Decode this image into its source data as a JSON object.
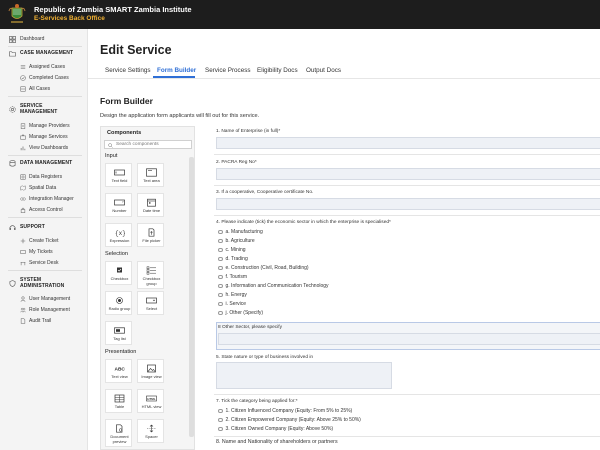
{
  "header": {
    "title": "Republic of Zambia SMART Zambia Institute",
    "subtitle": "E-Services Back Office"
  },
  "sidebar": {
    "dashboard": "Dashboard",
    "sections": [
      {
        "title": "CASE MANAGEMENT",
        "items": [
          "Assigned Cases",
          "Completed Cases",
          "All Cases"
        ]
      },
      {
        "title": "SERVICE\nMANAGEMENT",
        "items": [
          "Manage Providers",
          "Manage Services",
          "View Dashboards"
        ]
      },
      {
        "title": "DATA MANAGEMENT",
        "items": [
          "Data Registers",
          "Spatial Data",
          "Integration Manager",
          "Access Control"
        ]
      },
      {
        "title": "SUPPORT",
        "items": [
          "Create Ticket",
          "My Tickets",
          "Service Desk"
        ]
      },
      {
        "title": "SYSTEM\nADMINISTRATION",
        "items": [
          "User Management",
          "Role Management",
          "Audit Trail"
        ]
      }
    ]
  },
  "page": {
    "title": "Edit Service",
    "tabs": [
      "Service Settings",
      "Form Builder",
      "Service Process",
      "Eligibility Docs",
      "Output Docs"
    ],
    "active_tab": "Form Builder"
  },
  "form_builder": {
    "title": "Form Builder",
    "description": "Design the application form applicants will fill out for this service."
  },
  "components": {
    "title": "Components",
    "search_placeholder": "Search components",
    "sections": [
      {
        "label": "Input",
        "items": [
          {
            "label": "Text field",
            "icon": "text-field-icon"
          },
          {
            "label": "Text area",
            "icon": "text-area-icon"
          },
          {
            "label": "Number",
            "icon": "number-icon"
          },
          {
            "label": "Date time",
            "icon": "date-time-icon"
          },
          {
            "label": "Expression",
            "icon": "expression-icon"
          },
          {
            "label": "File picker",
            "icon": "file-picker-icon"
          }
        ]
      },
      {
        "label": "Selection",
        "items": [
          {
            "label": "Checkbox",
            "icon": "checkbox-icon"
          },
          {
            "label": "Checkbox group",
            "icon": "checkbox-group-icon"
          },
          {
            "label": "Radio group",
            "icon": "radio-group-icon"
          },
          {
            "label": "Select",
            "icon": "select-icon"
          },
          {
            "label": "Tag list",
            "icon": "tag-list-icon"
          }
        ]
      },
      {
        "label": "Presentation",
        "items": [
          {
            "label": "Text view",
            "icon": "text-view-icon"
          },
          {
            "label": "Image view",
            "icon": "image-view-icon"
          },
          {
            "label": "Table",
            "icon": "table-icon"
          },
          {
            "label": "HTML view",
            "icon": "html-view-icon"
          },
          {
            "label": "Document preview",
            "icon": "document-preview-icon"
          },
          {
            "label": "Spacer",
            "icon": "spacer-icon"
          }
        ]
      }
    ]
  },
  "form": {
    "q1": "1. Name of Enterprise (in full)*",
    "q2": "2. PACRA Reg No*",
    "q3": "3. If a cooperative, Cooperative certificate No.",
    "q4": "4. Please indicate (tick) the economic sector in which the enterprise is specialised*",
    "q4_options": [
      "a. Manufacturing",
      "b. Agriculture",
      "c. Mining",
      "d. Trading",
      "e. Construction (Civil, Road, Building)",
      "f. Tourism",
      "g. Information and Communication Technology",
      "h. Energy",
      "i. Service",
      "j. Other (Specify)"
    ],
    "q8": "8 Other Sector, please specify",
    "q5": "5. State nature or type of business involved in",
    "q7": "7. Tick the category being applied for:*",
    "q7_options": [
      "1. Citizen Influenced Company (Equity: From 5% to 25%)",
      "2. Citizen Empowered Company (Equity: Above 25% to 50%)",
      "3. Citizen Owned Company (Equity: Above 50%)"
    ],
    "q8b": "8. Name and Nationality of shareholders or partners"
  }
}
